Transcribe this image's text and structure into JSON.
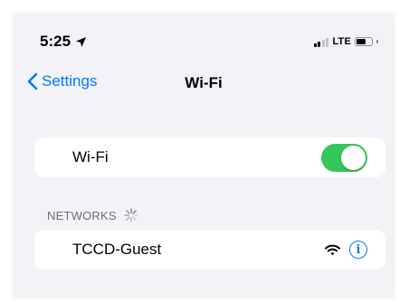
{
  "status_bar": {
    "time": "5:25",
    "location_icon": "location-arrow-icon",
    "network_type": "LTE",
    "signal_bars_active": 2,
    "signal_bars_total": 4,
    "battery_level": 0.6
  },
  "nav": {
    "back_label": "Settings",
    "title": "Wi-Fi"
  },
  "wifi_toggle": {
    "label": "Wi-Fi",
    "on": true
  },
  "networks": {
    "header": "NETWORKS",
    "items": [
      {
        "name": "TCCD-Guest",
        "icons": [
          "wifi-icon",
          "info-icon"
        ]
      }
    ]
  },
  "colors": {
    "accent": "#007aff",
    "toggle_on": "#34c759",
    "background": "#f2f2f7",
    "cell": "#ffffff",
    "secondary_text": "#6d6d72"
  }
}
